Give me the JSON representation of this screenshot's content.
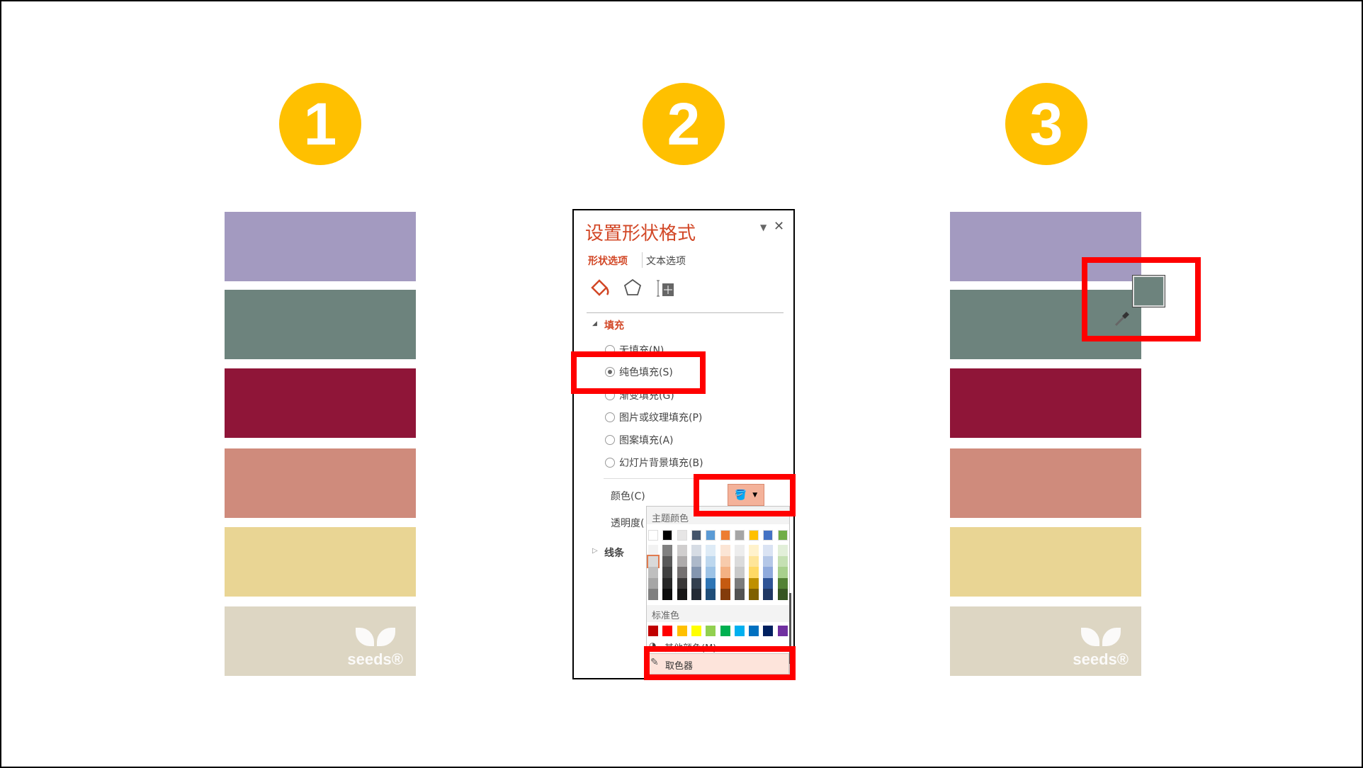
{
  "steps": [
    "1",
    "2",
    "3"
  ],
  "palette": [
    "#a39ac0",
    "#6d837d",
    "#8f1538",
    "#cf8b7c",
    "#e9d594",
    "#ddd6c3"
  ],
  "logo": "seeds®",
  "panel": {
    "title": "设置形状格式",
    "tabs": [
      "形状选项",
      "文本选项"
    ],
    "section_fill": "填充",
    "fill_options": [
      {
        "label": "无填充(N)",
        "selected": false
      },
      {
        "label": "纯色填充(S)",
        "selected": true
      },
      {
        "label": "渐变填充(G)",
        "selected": false
      },
      {
        "label": "图片或纹理填充(P)",
        "selected": false
      },
      {
        "label": "图案填充(A)",
        "selected": false
      },
      {
        "label": "幻灯片背景填充(B)",
        "selected": false
      }
    ],
    "color_label": "颜色(C)",
    "transparency_label": "透明度(",
    "section_line": "线条",
    "color_button": "#f4b29a"
  },
  "dropdown": {
    "theme_label": "主题颜色",
    "theme_colors": [
      "#ffffff",
      "#000000",
      "#e7e6e6",
      "#44546a",
      "#5b9bd5",
      "#ed7d31",
      "#a5a5a5",
      "#ffc000",
      "#4472c4",
      "#70ad47"
    ],
    "shades": [
      [
        "#f2f2f2",
        "#d9d9d9",
        "#bfbfbf",
        "#a6a6a6",
        "#808080"
      ],
      [
        "#808080",
        "#595959",
        "#404040",
        "#262626",
        "#0d0d0d"
      ],
      [
        "#d0cece",
        "#aeabab",
        "#757171",
        "#3a3838",
        "#171616"
      ],
      [
        "#d6dce4",
        "#adb9ca",
        "#8496b0",
        "#323f4f",
        "#222a35"
      ],
      [
        "#deebf6",
        "#bdd7ee",
        "#9dc3e6",
        "#2e75b5",
        "#1f4e79"
      ],
      [
        "#fbe5d5",
        "#f7cbac",
        "#f4b183",
        "#c55a11",
        "#833c0b"
      ],
      [
        "#ededed",
        "#dbdbdb",
        "#c9c9c9",
        "#7b7b7b",
        "#525252"
      ],
      [
        "#fff2cc",
        "#fee599",
        "#ffd965",
        "#bf9000",
        "#7f6000"
      ],
      [
        "#dae3f3",
        "#b4c7e7",
        "#8faadc",
        "#2f5496",
        "#203864"
      ],
      [
        "#e2efd9",
        "#c5e0b3",
        "#a8d08d",
        "#538135",
        "#375623"
      ]
    ],
    "standard_label": "标准色",
    "standard_colors": [
      "#c00000",
      "#ff0000",
      "#ffc000",
      "#ffff00",
      "#92d050",
      "#00b050",
      "#00b0f0",
      "#0070c0",
      "#002060",
      "#7030a0"
    ],
    "more_colors": "其他颜色(M)...",
    "eyedropper": "取色器"
  }
}
